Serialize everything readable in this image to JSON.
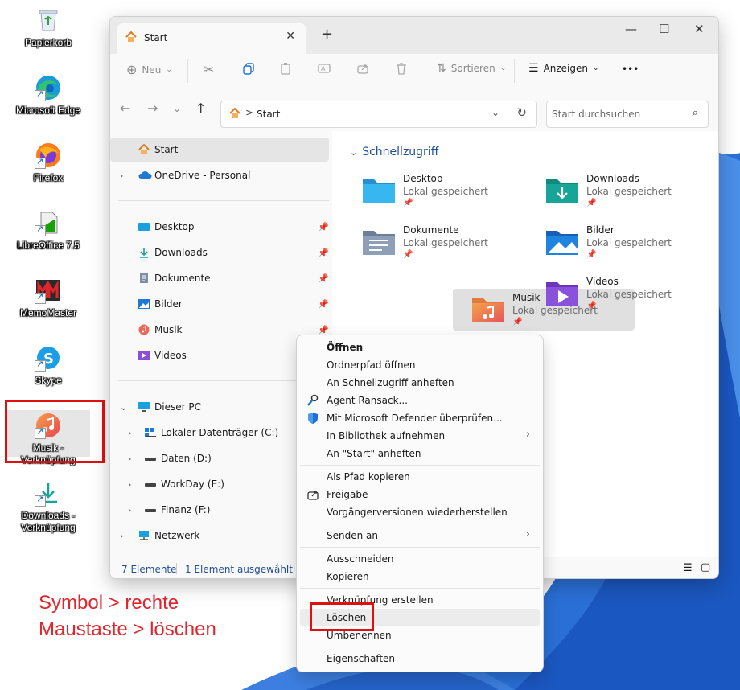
{
  "desktop": {
    "icons": [
      {
        "name": "recycle-bin",
        "label": "Papierkorb"
      },
      {
        "name": "edge",
        "label": "Microsoft Edge"
      },
      {
        "name": "firefox",
        "label": "Firefox"
      },
      {
        "name": "libreoffice",
        "label": "LibreOffice 7.5"
      },
      {
        "name": "memomaster",
        "label": "MemoMaster"
      },
      {
        "name": "skype",
        "label": "Skype"
      },
      {
        "name": "musik-shortcut",
        "label": "Musik - Verknüpfung"
      },
      {
        "name": "downloads-shortcut",
        "label": "Downloads -\nVerknüpfung"
      }
    ],
    "annotation_line1": "Symbol > rechte",
    "annotation_line2": "Maustaste > löschen"
  },
  "window": {
    "tab_title": "Start",
    "new_tab": "+",
    "controls": {
      "minimize": "—",
      "maximize": "☐",
      "close": "✕"
    }
  },
  "toolbar": {
    "new_label": "Neu",
    "sort_label": "Sortieren",
    "view_label": "Anzeigen",
    "more": "•••"
  },
  "address": {
    "crumb": "Start",
    "separator": ">",
    "search_placeholder": "Start durchsuchen"
  },
  "nav": {
    "start": "Start",
    "onedrive": "OneDrive - Personal",
    "pinned": [
      "Desktop",
      "Downloads",
      "Dokumente",
      "Bilder",
      "Musik",
      "Videos"
    ],
    "dieser_pc": "Dieser PC",
    "drives": [
      "Lokaler Datenträger (C:)",
      "Daten (D:)",
      "WorkDay (E:)",
      "Finanz (F:)"
    ],
    "netzwerk": "Netzwerk"
  },
  "content": {
    "section": "Schnellzugriff",
    "items": [
      {
        "name": "Desktop",
        "sub": "Lokal gespeichert"
      },
      {
        "name": "Downloads",
        "sub": "Lokal gespeichert"
      },
      {
        "name": "Dokumente",
        "sub": "Lokal gespeichert"
      },
      {
        "name": "Bilder",
        "sub": "Lokal gespeichert"
      },
      {
        "name": "Musik",
        "sub": "Lokal gespeichert"
      },
      {
        "name": "Videos",
        "sub": "Lokal gespeichert"
      }
    ]
  },
  "status": {
    "count": "7 Elemente",
    "selected": "1 Element ausgewählt"
  },
  "context_menu": {
    "items": [
      "Öffnen",
      "Ordnerpfad öffnen",
      "An Schnellzugriff anheften",
      "Agent Ransack...",
      "Mit Microsoft Defender überprüfen...",
      "In Bibliothek aufnehmen",
      "An \"Start\" anheften",
      "Als Pfad kopieren",
      "Freigabe",
      "Vorgängerversionen wiederherstellen",
      "Senden an",
      "Ausschneiden",
      "Kopieren",
      "Verknüpfung erstellen",
      "Löschen",
      "Umbenennen",
      "Eigenschaften"
    ]
  },
  "colors": {
    "accent": "#1f4e9a",
    "highlight_red": "#e01010",
    "annotation_red": "#e3242b",
    "folder_blue": "#3aa0e0"
  }
}
